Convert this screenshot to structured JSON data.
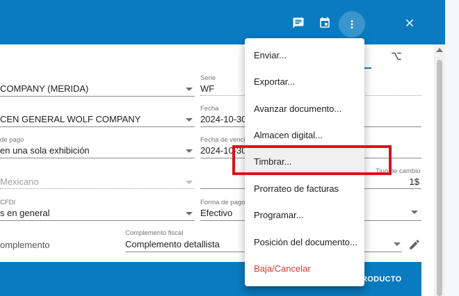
{
  "toolbar": {
    "accent": "#0a7bc0",
    "icons": [
      "comment-icon",
      "calendar-icon",
      "more-vert-icon",
      "close-icon"
    ]
  },
  "form": {
    "row1": {
      "left_value": "COMPANY (MERIDA)",
      "right_label": "Serie",
      "right_value": "WF"
    },
    "row2": {
      "left_value": "CEN GENERAL WOLF COMPANY",
      "right_label": "Fecha",
      "right_value": "2024-10-30"
    },
    "row3": {
      "left_label": "de pago",
      "left_value": "en una sola exhibición",
      "right_label": "Fecha de venci",
      "right_value": "2024-10-30"
    },
    "row4": {
      "left_value": "Mexicano",
      "right_label": "Tipo de cambio",
      "right_value": "1$"
    },
    "row5": {
      "left_label": "CFDI",
      "left_value": "s en general",
      "right_label": "Forma de pago",
      "right_value": "Efectivo"
    },
    "row6": {
      "left_value": "omplemento",
      "mid_label": "Complemento fiscal",
      "mid_value": "Complemento detallista"
    }
  },
  "bottom_bar": {
    "button_label": "RODUCTO"
  },
  "menu": {
    "items": [
      "Enviar...",
      "Exportar...",
      "Avanzar documento...",
      "Almacen digital...",
      "Timbrar...",
      "Prorrateo de facturas",
      "Programar...",
      "Posición del documento...",
      "Baja/Cancelar"
    ],
    "highlighted_index": 4,
    "danger_color": "#e53935"
  }
}
